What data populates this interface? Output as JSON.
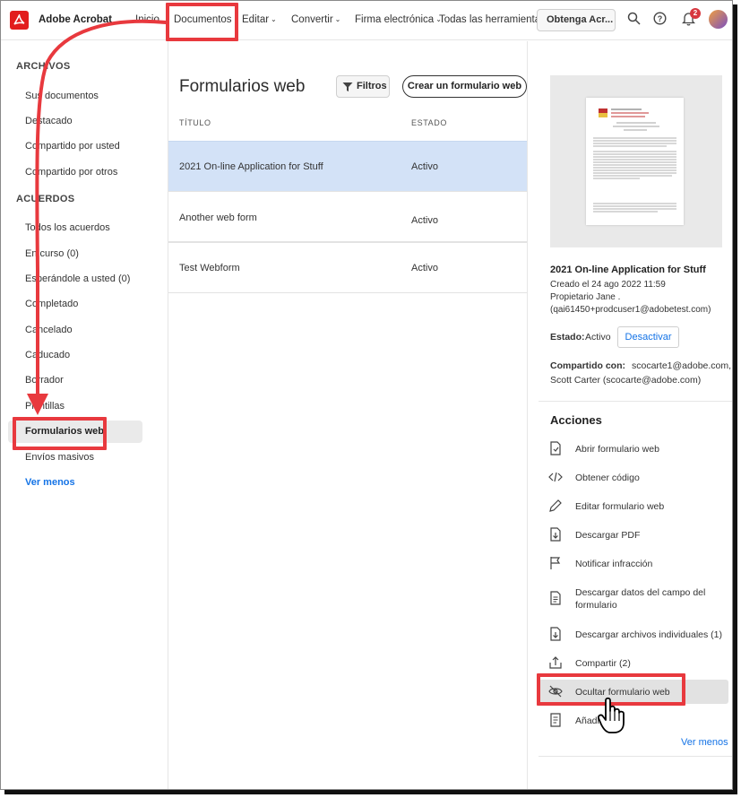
{
  "topbar": {
    "app_name": "Adobe Acrobat",
    "nav": [
      "Inicio",
      "Documentos",
      "Editar",
      "Convertir",
      "Firma electrónica",
      "Todas las herramientas"
    ],
    "get_button": "Obtenga Acr...",
    "notification_count": "2",
    "icons": [
      "search-icon",
      "help-icon",
      "bell-icon",
      "avatar"
    ]
  },
  "sidebar": {
    "section_archivos": "ARCHIVOS",
    "archivos": [
      "Sus documentos",
      "Destacado",
      "Compartido por usted",
      "Compartido por otros"
    ],
    "section_acuerdos": "ACUERDOS",
    "acuerdos": [
      "Todos los acuerdos",
      "En curso (0)",
      "Esperándole a usted (0)",
      "Completado",
      "Cancelado",
      "Caducado",
      "Borrador",
      "Plantillas",
      "Formularios web",
      "Envíos masivos"
    ],
    "ver_menos": "Ver menos"
  },
  "main": {
    "title": "Formularios web",
    "filter_button": "Filtros",
    "create_button": "Crear un formulario web",
    "col_title": "TÍTULO",
    "col_status": "ESTADO",
    "rows": [
      {
        "title": "2021 On-line Application for Stuff",
        "status": "Activo"
      },
      {
        "title": "Another web form",
        "status": "Activo"
      },
      {
        "title": "Test Webform",
        "status": "Activo"
      }
    ]
  },
  "detail": {
    "title": "2021 On-line Application for Stuff",
    "created": "Creado el 24 ago 2022 11:59",
    "owner": "Propietario Jane .",
    "owner_email": "(qai61450+prodcuser1@adobetest.com)",
    "status_label": "Estado:",
    "status_value": "Activo",
    "deactivate": "Desactivar",
    "shared_label": "Compartido con:",
    "shared_value_1": "scocarte1@adobe.com,",
    "shared_value_2": "Scott Carter (scocarte@adobe.com)",
    "actions_title": "Acciones",
    "actions": [
      "Abrir formulario web",
      "Obtener código",
      "Editar formulario web",
      "Descargar PDF",
      "Notificar infracción",
      "Descargar datos del campo del formulario",
      "Descargar archivos individuales (1)",
      "Compartir (2)",
      "Ocultar formulario web",
      "Añadir"
    ],
    "ver_menos": "Ver menos"
  },
  "colors": {
    "accent_blue": "#1473e6",
    "selected_row": "#d3e2f7",
    "annotation_red": "#e8393e",
    "acrobat_red": "#e21c1c"
  }
}
